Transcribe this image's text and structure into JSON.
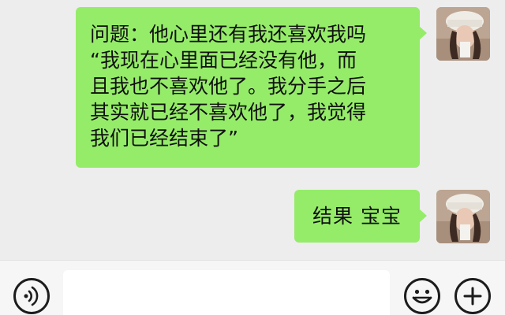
{
  "chat": {
    "messages": [
      {
        "sender": "self",
        "lines": [
          "问题：他心里还有我还喜欢我吗",
          "“我现在心里面已经没有他，而",
          "且我也不喜欢他了。我分手之后",
          "其实就已经不喜欢他了，我觉得",
          "我们已经结束了”"
        ]
      },
      {
        "sender": "self",
        "lines": [
          "结果 宝宝"
        ]
      }
    ]
  },
  "input_bar": {
    "voice_icon": "voice-icon",
    "text_value": "",
    "emoji_icon": "emoji-icon",
    "plus_icon": "plus-icon"
  },
  "colors": {
    "bubble": "#95ec69",
    "background": "#ededed",
    "input_bar": "#f6f6f6"
  }
}
